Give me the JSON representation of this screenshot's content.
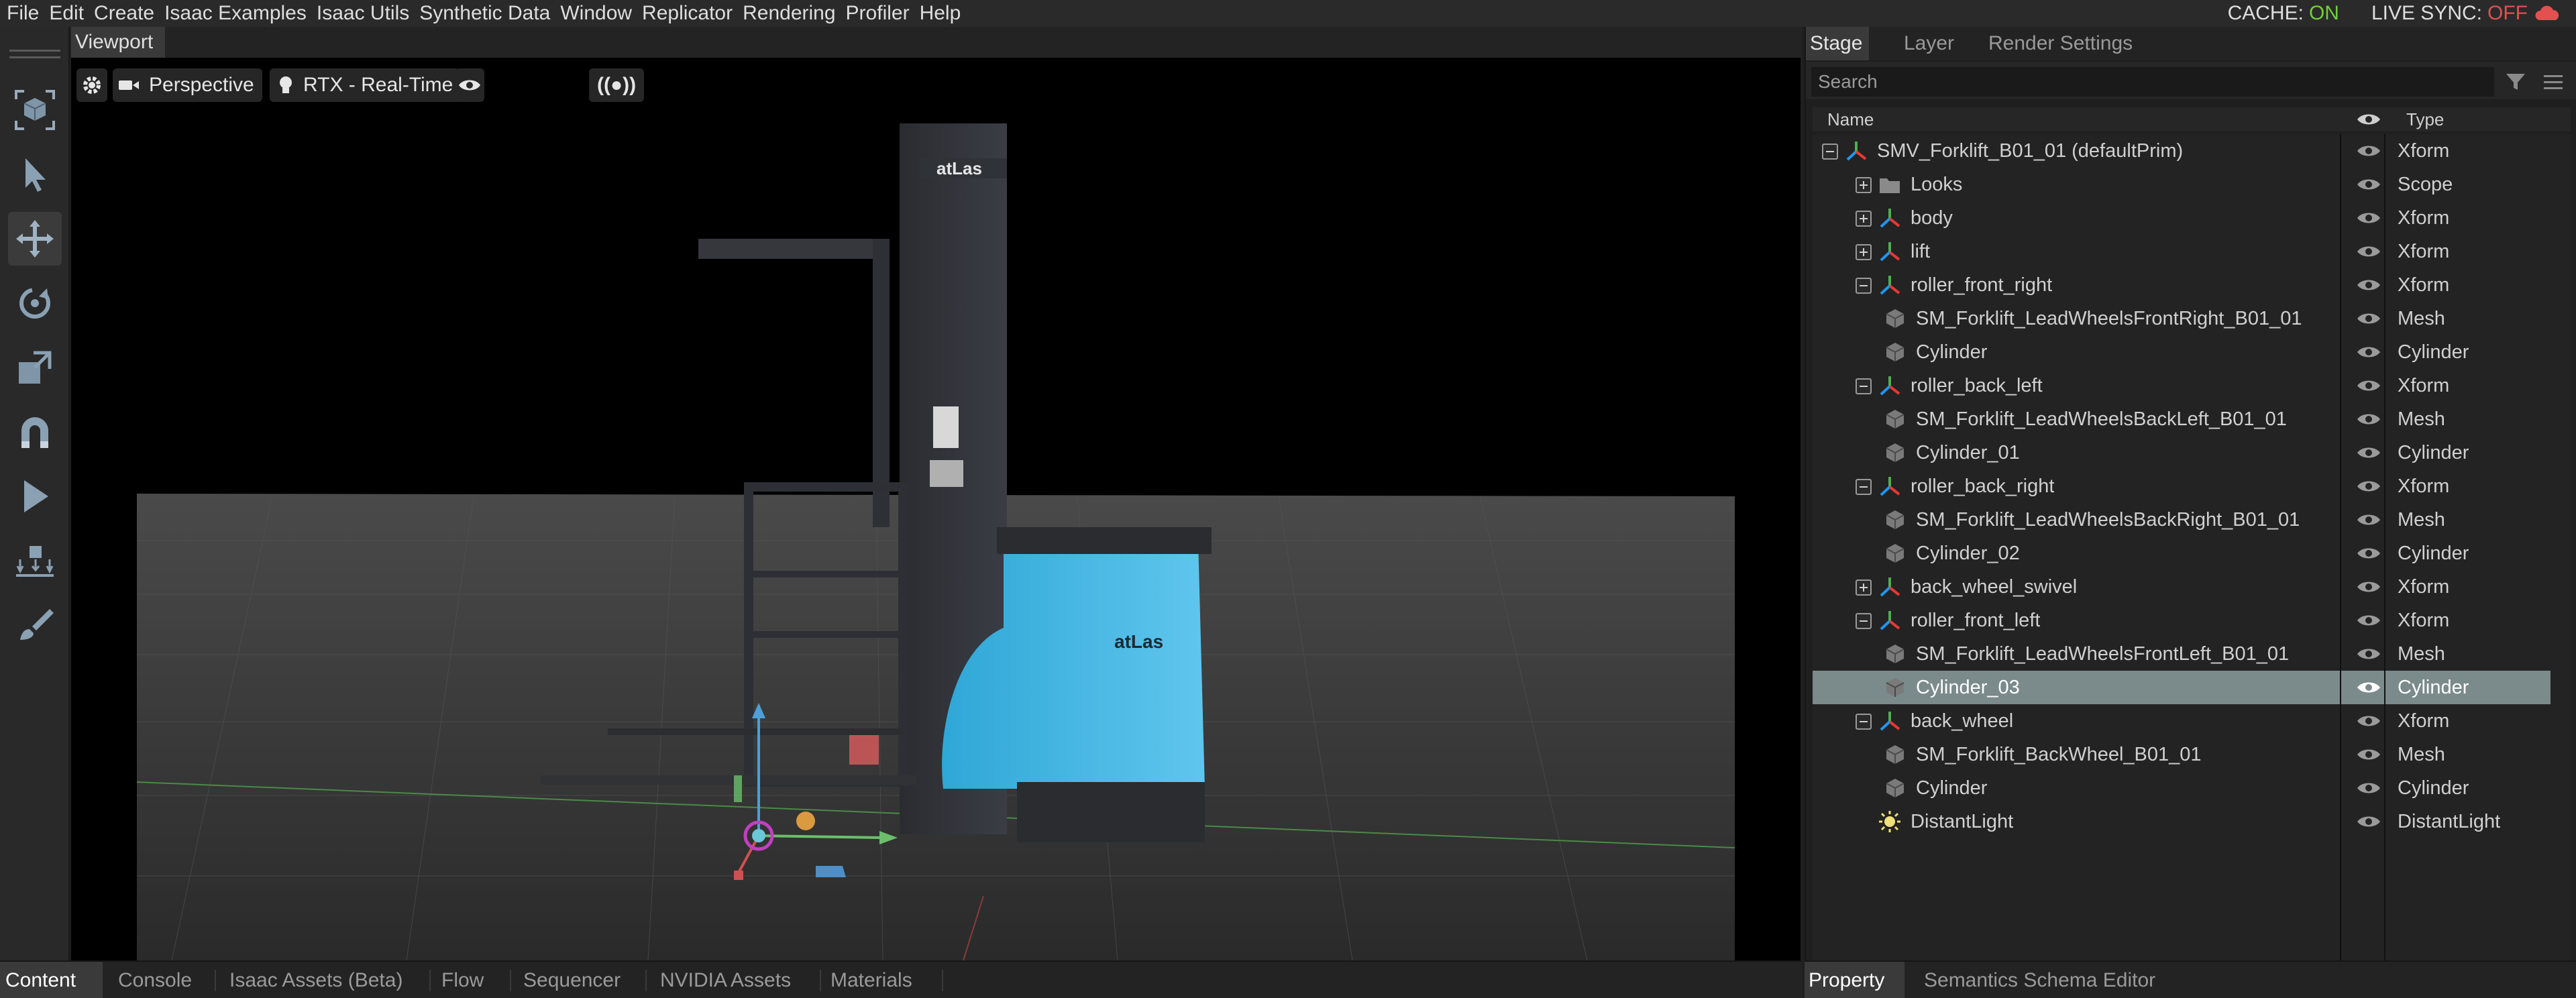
{
  "menu": [
    "File",
    "Edit",
    "Create",
    "Isaac Examples",
    "Isaac Utils",
    "Synthetic Data",
    "Window",
    "Replicator",
    "Rendering",
    "Profiler",
    "Help"
  ],
  "status": {
    "cache_label": "CACHE:",
    "cache_value": "ON",
    "live_sync_label": "LIVE SYNC:",
    "live_sync_value": "OFF",
    "on_color": "#6fcf3a",
    "off_color": "#e25050"
  },
  "toolbar": {
    "tools": [
      "select-mode-icon",
      "select-arrow-icon",
      "move-icon",
      "rotate-icon",
      "scale-icon",
      "snap-icon",
      "play-icon",
      "drop-to-ground-icon",
      "paint-icon"
    ],
    "active_tool": "move-icon"
  },
  "viewport": {
    "tab_label": "Viewport",
    "camera_label": "Perspective",
    "renderer_label": "RTX - Real-Time",
    "broadcast_label": "((●))",
    "object_logo": "atLas"
  },
  "stage": {
    "tabs": [
      "Stage",
      "Layer",
      "Render Settings"
    ],
    "active_tab": "Stage",
    "search_placeholder": "Search",
    "col_name": "Name",
    "col_type": "Type",
    "tree": [
      {
        "name": "SMV_Forklift_B01_01 (defaultPrim)",
        "type": "Xform",
        "depth": 0,
        "expander": "minus",
        "icon": "xform"
      },
      {
        "name": "Looks",
        "type": "Scope",
        "depth": 1,
        "expander": "plus",
        "icon": "folder"
      },
      {
        "name": "body",
        "type": "Xform",
        "depth": 1,
        "expander": "plus",
        "icon": "xform"
      },
      {
        "name": "lift",
        "type": "Xform",
        "depth": 1,
        "expander": "plus",
        "icon": "xform"
      },
      {
        "name": "roller_front_right",
        "type": "Xform",
        "depth": 1,
        "expander": "minus",
        "icon": "xform"
      },
      {
        "name": "SM_Forklift_LeadWheelsFrontRight_B01_01",
        "type": "Mesh",
        "depth": 2,
        "expander": "none",
        "icon": "cube"
      },
      {
        "name": "Cylinder",
        "type": "Cylinder",
        "depth": 2,
        "expander": "none",
        "icon": "cube"
      },
      {
        "name": "roller_back_left",
        "type": "Xform",
        "depth": 1,
        "expander": "minus",
        "icon": "xform"
      },
      {
        "name": "SM_Forklift_LeadWheelsBackLeft_B01_01",
        "type": "Mesh",
        "depth": 2,
        "expander": "none",
        "icon": "cube"
      },
      {
        "name": "Cylinder_01",
        "type": "Cylinder",
        "depth": 2,
        "expander": "none",
        "icon": "cube"
      },
      {
        "name": "roller_back_right",
        "type": "Xform",
        "depth": 1,
        "expander": "minus",
        "icon": "xform"
      },
      {
        "name": "SM_Forklift_LeadWheelsBackRight_B01_01",
        "type": "Mesh",
        "depth": 2,
        "expander": "none",
        "icon": "cube"
      },
      {
        "name": "Cylinder_02",
        "type": "Cylinder",
        "depth": 2,
        "expander": "none",
        "icon": "cube"
      },
      {
        "name": "back_wheel_swivel",
        "type": "Xform",
        "depth": 1,
        "expander": "plus",
        "icon": "xform"
      },
      {
        "name": "roller_front_left",
        "type": "Xform",
        "depth": 1,
        "expander": "minus",
        "icon": "xform"
      },
      {
        "name": "SM_Forklift_LeadWheelsFrontLeft_B01_01",
        "type": "Mesh",
        "depth": 2,
        "expander": "none",
        "icon": "cube"
      },
      {
        "name": "Cylinder_03",
        "type": "Cylinder",
        "depth": 2,
        "expander": "none",
        "icon": "cube",
        "selected": true
      },
      {
        "name": "back_wheel",
        "type": "Xform",
        "depth": 1,
        "expander": "minus",
        "icon": "xform"
      },
      {
        "name": "SM_Forklift_BackWheel_B01_01",
        "type": "Mesh",
        "depth": 2,
        "expander": "none",
        "icon": "cube"
      },
      {
        "name": "Cylinder",
        "type": "Cylinder",
        "depth": 2,
        "expander": "none",
        "icon": "cube"
      },
      {
        "name": "DistantLight",
        "type": "DistantLight",
        "depth": 1,
        "expander": "none",
        "icon": "light"
      }
    ]
  },
  "bottom_tabs": {
    "left": [
      "Content",
      "Console",
      "Isaac Assets (Beta)",
      "Flow",
      "Sequencer",
      "NVIDIA Assets",
      "Materials"
    ],
    "left_active": "Content",
    "right": [
      "Property",
      "Semantics Schema Editor"
    ],
    "right_active": "Property"
  }
}
